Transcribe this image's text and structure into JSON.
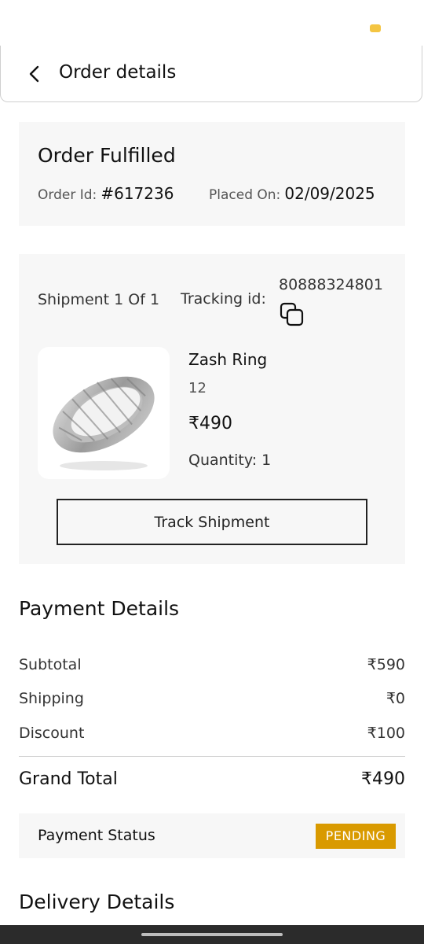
{
  "header": {
    "title": "Order details"
  },
  "order": {
    "status": "Order Fulfilled",
    "id_label": "Order Id:",
    "id_value": "#617236",
    "placed_label": "Placed On:",
    "placed_value": "02/09/2025"
  },
  "shipment": {
    "label": "Shipment 1 Of 1",
    "tracking_label": "Tracking id:",
    "tracking_number": "80888324801",
    "product": {
      "name": "Zash Ring",
      "variant": "12",
      "price": "₹490",
      "quantity": "Quantity: 1"
    },
    "track_button": "Track Shipment"
  },
  "payment": {
    "title": "Payment Details",
    "rows": [
      {
        "label": "Subtotal",
        "value": "₹590"
      },
      {
        "label": "Shipping",
        "value": "₹0"
      },
      {
        "label": "Discount",
        "value": "₹100"
      }
    ],
    "grand_total_label": "Grand Total",
    "grand_total_value": "₹490",
    "status_label": "Payment Status",
    "status_value": "PENDING",
    "status_color": "#d99a00"
  },
  "delivery": {
    "title": "Delivery Details"
  },
  "icons": [
    "back-arrow-icon",
    "copy-icon",
    "ring-image"
  ]
}
